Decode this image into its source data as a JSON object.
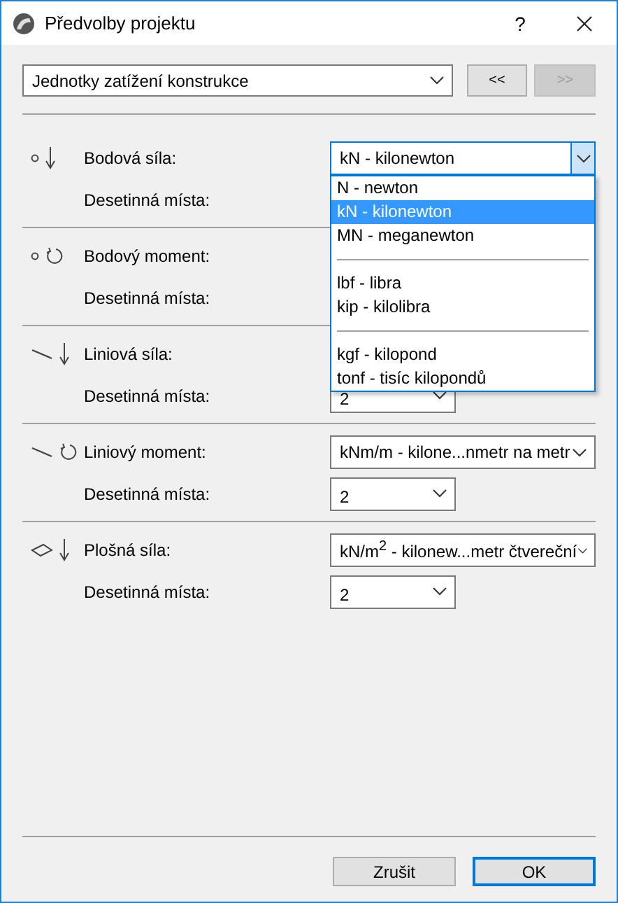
{
  "window": {
    "title": "Předvolby projektu",
    "help": "?"
  },
  "category_select": {
    "value": "Jednotky zatížení konstrukce"
  },
  "nav_buttons": [
    {
      "label": "<<",
      "disabled": false
    },
    {
      "label": ">>",
      "disabled": true
    }
  ],
  "sections": [
    {
      "kind": "point_force",
      "label": "Bodová síla:",
      "unit": {
        "value": "kN - kilonewton",
        "open": true
      },
      "decimals_label": "Desetinná místa:"
    },
    {
      "kind": "point_moment",
      "label": "Bodový moment:",
      "decimals_label": "Desetinná místa:"
    },
    {
      "kind": "line_force",
      "label": "Liniová síla:",
      "decimals_label": "Desetinná místa:",
      "decimals": {
        "value": "2"
      }
    },
    {
      "kind": "line_moment",
      "label": "Liniový moment:",
      "unit": {
        "value": "kNm/m - kilone...nmetr na metr",
        "open": false
      },
      "decimals_label": "Desetinná místa:",
      "decimals": {
        "value": "2"
      }
    },
    {
      "kind": "area_force",
      "label": "Plošná síla:",
      "unit": {
        "value": "kN/m$^{2}$ - kilonew...metr čtvereční",
        "open": false
      },
      "decimals_label": "Desetinná místa:",
      "decimals": {
        "value": "2"
      }
    }
  ],
  "dropdown": {
    "options": [
      {
        "kind": "option",
        "label": "N - newton",
        "selected": false
      },
      {
        "kind": "option",
        "label": "kN - kilonewton",
        "selected": true
      },
      {
        "kind": "option",
        "label": "MN - meganewton",
        "selected": false
      },
      {
        "kind": "separator"
      },
      {
        "kind": "option",
        "label": "lbf - libra",
        "selected": false
      },
      {
        "kind": "option",
        "label": "kip - kilolibra",
        "selected": false
      },
      {
        "kind": "separator"
      },
      {
        "kind": "option",
        "label": "kgf - kilopond",
        "selected": false
      },
      {
        "kind": "option",
        "label": "tonf - tisíc kilopondů",
        "selected": false
      }
    ]
  },
  "buttons": [
    {
      "label": "Zrušit",
      "default": false
    },
    {
      "label": "OK",
      "default": true
    }
  ]
}
